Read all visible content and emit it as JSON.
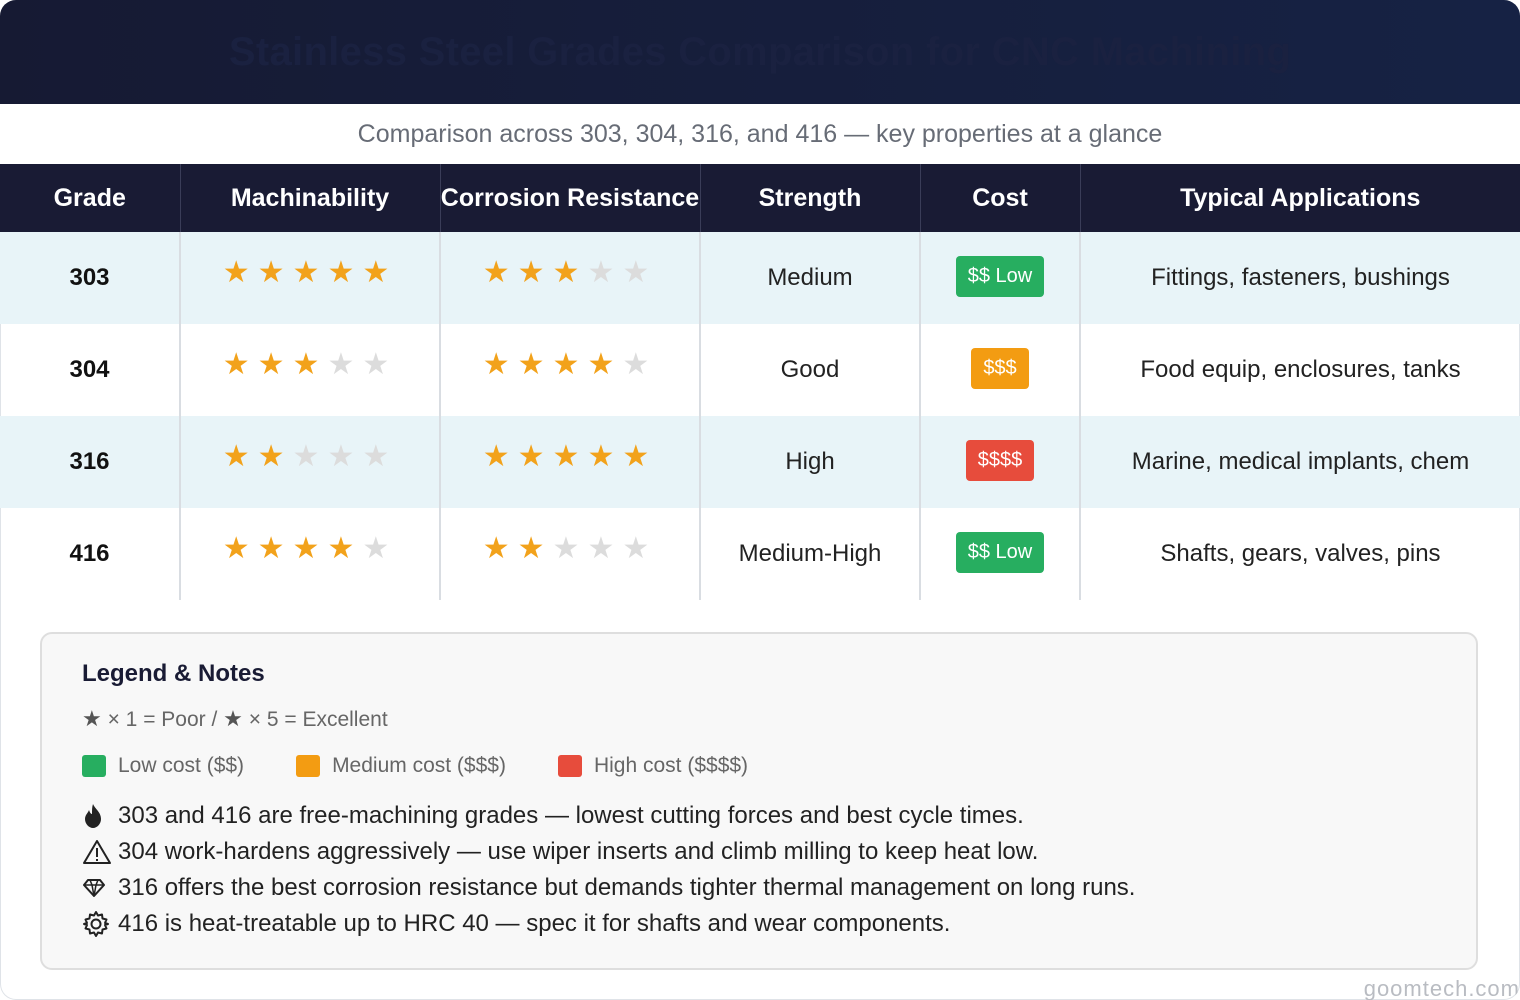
{
  "header": {
    "title": "Stainless Steel Grades Comparison for CNC Machining"
  },
  "subtitle": "Comparison across 303, 304, 316, and 416 — key properties at a glance",
  "table": {
    "columns": [
      "Grade",
      "Machinability",
      "Corrosion Resistance",
      "Strength",
      "Cost",
      "Typical Applications"
    ],
    "rows": [
      {
        "grade": "303",
        "machinability": 5,
        "corrosion": 3,
        "strength": "Medium",
        "cost": "$$ Low",
        "cost_level": "low",
        "applications": "Fittings, fasteners, bushings"
      },
      {
        "grade": "304",
        "machinability": 3,
        "corrosion": 4,
        "strength": "Good",
        "cost": "$$$",
        "cost_level": "medium",
        "applications": "Food equip, enclosures, tanks"
      },
      {
        "grade": "316",
        "machinability": 2,
        "corrosion": 5,
        "strength": "High",
        "cost": "$$$$",
        "cost_level": "high",
        "applications": "Marine, medical implants, chem"
      },
      {
        "grade": "416",
        "machinability": 4,
        "corrosion": 2,
        "strength": "Medium-High",
        "cost": "$$ Low",
        "cost_level": "low",
        "applications": "Shafts, gears, valves, pins"
      }
    ],
    "max_stars": 5
  },
  "colors": {
    "header_bg": "#191b34",
    "star_on": "#f2a21b",
    "star_off": "#dcdcdc",
    "low": "#27ae60",
    "medium": "#f39c12",
    "high": "#e74c3c",
    "alt_row": "#e8f4f8"
  },
  "legend": {
    "title": "Legend & Notes",
    "scale_a": "× 1 = Poor /",
    "scale_b": "× 5 = Excellent",
    "swatches": [
      {
        "label": "Low cost ($$)",
        "level": "low"
      },
      {
        "label": "Medium cost ($$$)",
        "level": "medium"
      },
      {
        "label": "High cost ($$$$)",
        "level": "high"
      }
    ],
    "notes": [
      {
        "icon": "flame-icon",
        "text": "303 and 416 are free-machining grades — lowest cutting forces and best cycle times."
      },
      {
        "icon": "warning-icon",
        "text": "304 work-hardens aggressively — use wiper inserts and climb milling to keep heat low."
      },
      {
        "icon": "diamond-icon",
        "text": "316 offers the best corrosion resistance but demands tighter thermal management on long runs."
      },
      {
        "icon": "gear-icon",
        "text": "416 is heat-treatable up to HRC 40 — spec it for shafts and wear components."
      }
    ]
  },
  "watermark": "goomtech.com"
}
